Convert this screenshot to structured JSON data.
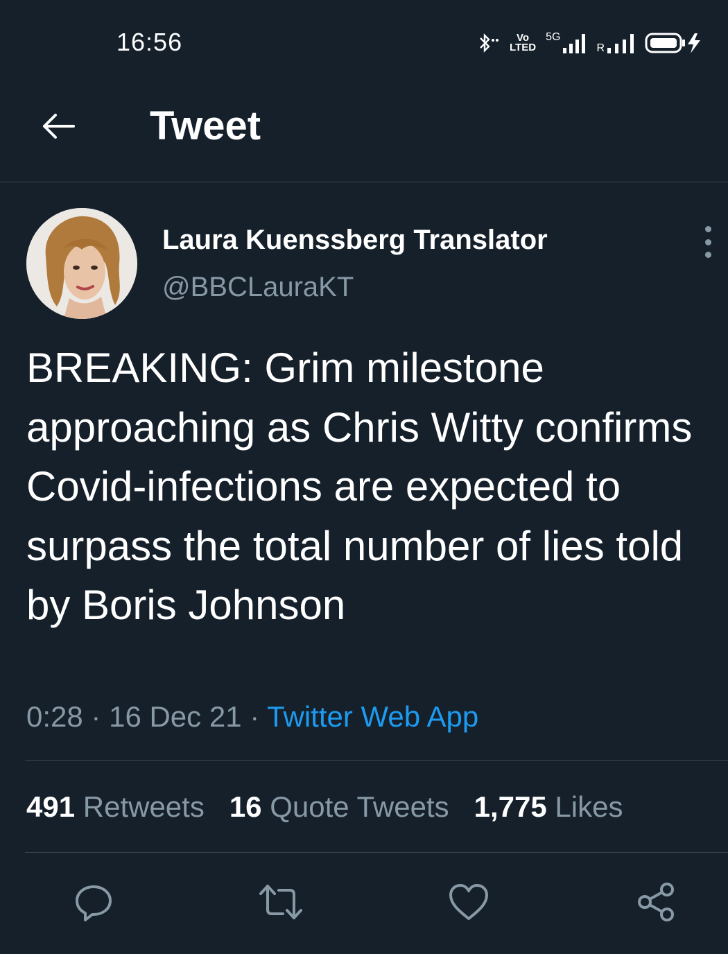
{
  "status_bar": {
    "time": "16:56",
    "volte_top": "Vo",
    "volte_bottom": "LTED",
    "network": "5G",
    "roaming": "R"
  },
  "header": {
    "title": "Tweet"
  },
  "tweet": {
    "author_name": "Laura Kuenssberg Translator",
    "handle": "@BBCLauraKT",
    "text": "BREAKING: Grim milestone approaching as Chris Witty confirms Covid-infections are expected to surpass the total number of lies told by Boris Johnson",
    "time": "0:28",
    "date": "16 Dec 21",
    "separator": "·",
    "source": "Twitter Web App"
  },
  "stats": {
    "retweets_count": "491",
    "retweets_label": "Retweets",
    "quotes_count": "16",
    "quotes_label": "Quote Tweets",
    "likes_count": "1,775",
    "likes_label": "Likes"
  },
  "icons": {
    "back": "arrow-left-icon",
    "more": "more-vertical-icon",
    "reply": "reply-icon",
    "retweet": "retweet-icon",
    "like": "heart-icon",
    "share": "share-icon"
  },
  "colors": {
    "background": "#15202b",
    "text": "#ffffff",
    "secondary": "#8899a6",
    "accent": "#1d9bf0",
    "divider": "#38444d"
  }
}
